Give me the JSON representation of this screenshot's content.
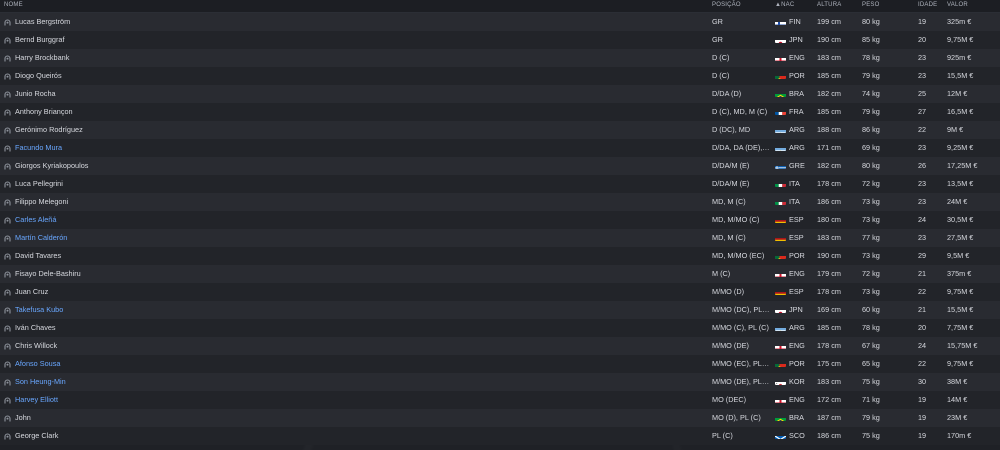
{
  "columns": {
    "nome": "NOME",
    "posicao": "POSIÇÃO",
    "nac_arrow": "▲",
    "nac": "NAC",
    "altura": "ALTURA",
    "peso": "PESO",
    "idade": "IDADE",
    "valor": "VALOR"
  },
  "players": [
    {
      "name": "Lucas Bergström",
      "highlight": false,
      "pos": "GR",
      "nat": "FIN",
      "flag": "fin",
      "height": "199 cm",
      "weight": "80 kg",
      "age": "19",
      "value": "325m €"
    },
    {
      "name": "Bernd Burggraf",
      "highlight": false,
      "pos": "GR",
      "nat": "JPN",
      "flag": "jpn",
      "height": "190 cm",
      "weight": "85 kg",
      "age": "20",
      "value": "9,75M €"
    },
    {
      "name": "Harry Brockbank",
      "highlight": false,
      "pos": "D (C)",
      "nat": "ENG",
      "flag": "eng",
      "height": "183 cm",
      "weight": "78 kg",
      "age": "23",
      "value": "925m €"
    },
    {
      "name": "Diogo Queirós",
      "highlight": false,
      "pos": "D (C)",
      "nat": "POR",
      "flag": "por",
      "height": "185 cm",
      "weight": "79 kg",
      "age": "23",
      "value": "15,5M €"
    },
    {
      "name": "Junio Rocha",
      "highlight": false,
      "pos": "D/DA (D)",
      "nat": "BRA",
      "flag": "bra",
      "height": "182 cm",
      "weight": "74 kg",
      "age": "25",
      "value": "12M €"
    },
    {
      "name": "Anthony Briançon",
      "highlight": false,
      "pos": "D (C), MD, M (C)",
      "nat": "FRA",
      "flag": "fra",
      "height": "185 cm",
      "weight": "79 kg",
      "age": "27",
      "value": "16,5M €"
    },
    {
      "name": "Gerónimo Rodríguez",
      "highlight": false,
      "pos": "D (DC), MD",
      "nat": "ARG",
      "flag": "arg",
      "height": "188 cm",
      "weight": "86 kg",
      "age": "22",
      "value": "9M €"
    },
    {
      "name": "Facundo Mura",
      "highlight": true,
      "pos": "D/DA, DA (DE),…",
      "nat": "ARG",
      "flag": "arg",
      "height": "171 cm",
      "weight": "69 kg",
      "age": "23",
      "value": "9,25M €"
    },
    {
      "name": "Giorgos Kyriakopoulos",
      "highlight": false,
      "pos": "D/DA/M (E)",
      "nat": "GRE",
      "flag": "gre",
      "height": "182 cm",
      "weight": "80 kg",
      "age": "26",
      "value": "17,25M €"
    },
    {
      "name": "Luca Pellegrini",
      "highlight": false,
      "pos": "D/DA/M (E)",
      "nat": "ITA",
      "flag": "ita",
      "height": "178 cm",
      "weight": "72 kg",
      "age": "23",
      "value": "13,5M €"
    },
    {
      "name": "Filippo Melegoni",
      "highlight": false,
      "pos": "MD, M (C)",
      "nat": "ITA",
      "flag": "ita",
      "height": "186 cm",
      "weight": "73 kg",
      "age": "23",
      "value": "24M €"
    },
    {
      "name": "Carles Aleñá",
      "highlight": true,
      "pos": "MD, M/MO (C)",
      "nat": "ESP",
      "flag": "esp",
      "height": "180 cm",
      "weight": "73 kg",
      "age": "24",
      "value": "30,5M €"
    },
    {
      "name": "Martín Calderón",
      "highlight": true,
      "pos": "MD, M (C)",
      "nat": "ESP",
      "flag": "esp",
      "height": "183 cm",
      "weight": "77 kg",
      "age": "23",
      "value": "27,5M €"
    },
    {
      "name": "David Tavares",
      "highlight": false,
      "pos": "MD, M/MO (EC)",
      "nat": "POR",
      "flag": "por",
      "height": "190 cm",
      "weight": "73 kg",
      "age": "29",
      "value": "9,5M €"
    },
    {
      "name": "Fisayo Dele-Bashiru",
      "highlight": false,
      "pos": "M (C)",
      "nat": "ENG",
      "flag": "eng",
      "height": "179 cm",
      "weight": "72 kg",
      "age": "21",
      "value": "375m €"
    },
    {
      "name": "Juan Cruz",
      "highlight": false,
      "pos": "M/MO (D)",
      "nat": "ESP",
      "flag": "esp",
      "height": "178 cm",
      "weight": "73 kg",
      "age": "22",
      "value": "9,75M €"
    },
    {
      "name": "Takefusa Kubo",
      "highlight": true,
      "pos": "M/MO (DC), PL…",
      "nat": "JPN",
      "flag": "jpn",
      "height": "169 cm",
      "weight": "60 kg",
      "age": "21",
      "value": "15,5M €"
    },
    {
      "name": "Iván Chaves",
      "highlight": false,
      "pos": "M/MO (C), PL (C)",
      "nat": "ARG",
      "flag": "arg",
      "height": "185 cm",
      "weight": "78 kg",
      "age": "20",
      "value": "7,75M €"
    },
    {
      "name": "Chris Willock",
      "highlight": false,
      "pos": "M/MO (DE)",
      "nat": "ENG",
      "flag": "eng",
      "height": "178 cm",
      "weight": "67 kg",
      "age": "24",
      "value": "15,75M €"
    },
    {
      "name": "Afonso Sousa",
      "highlight": true,
      "pos": "M/MO (EC), PL…",
      "nat": "POR",
      "flag": "por",
      "height": "175 cm",
      "weight": "65 kg",
      "age": "22",
      "value": "9,75M €"
    },
    {
      "name": "Son Heung-Min",
      "highlight": true,
      "pos": "M/MO (DE), PL…",
      "nat": "KOR",
      "flag": "kor",
      "height": "183 cm",
      "weight": "75 kg",
      "age": "30",
      "value": "38M €"
    },
    {
      "name": "Harvey Elliott",
      "highlight": true,
      "pos": "MO (DEC)",
      "nat": "ENG",
      "flag": "eng",
      "height": "172 cm",
      "weight": "71 kg",
      "age": "19",
      "value": "14M €"
    },
    {
      "name": "John",
      "highlight": false,
      "pos": "MO (D), PL (C)",
      "nat": "BRA",
      "flag": "bra",
      "height": "187 cm",
      "weight": "79 kg",
      "age": "19",
      "value": "23M €"
    },
    {
      "name": "George Clark",
      "highlight": false,
      "pos": "PL (C)",
      "nat": "SCO",
      "flag": "sco",
      "height": "186 cm",
      "weight": "75 kg",
      "age": "19",
      "value": "170m €"
    }
  ],
  "colors": {
    "highlight_name": "#69a7ff",
    "row_odd": "#292b31",
    "row_even": "#222429",
    "text": "#d7d9df"
  }
}
